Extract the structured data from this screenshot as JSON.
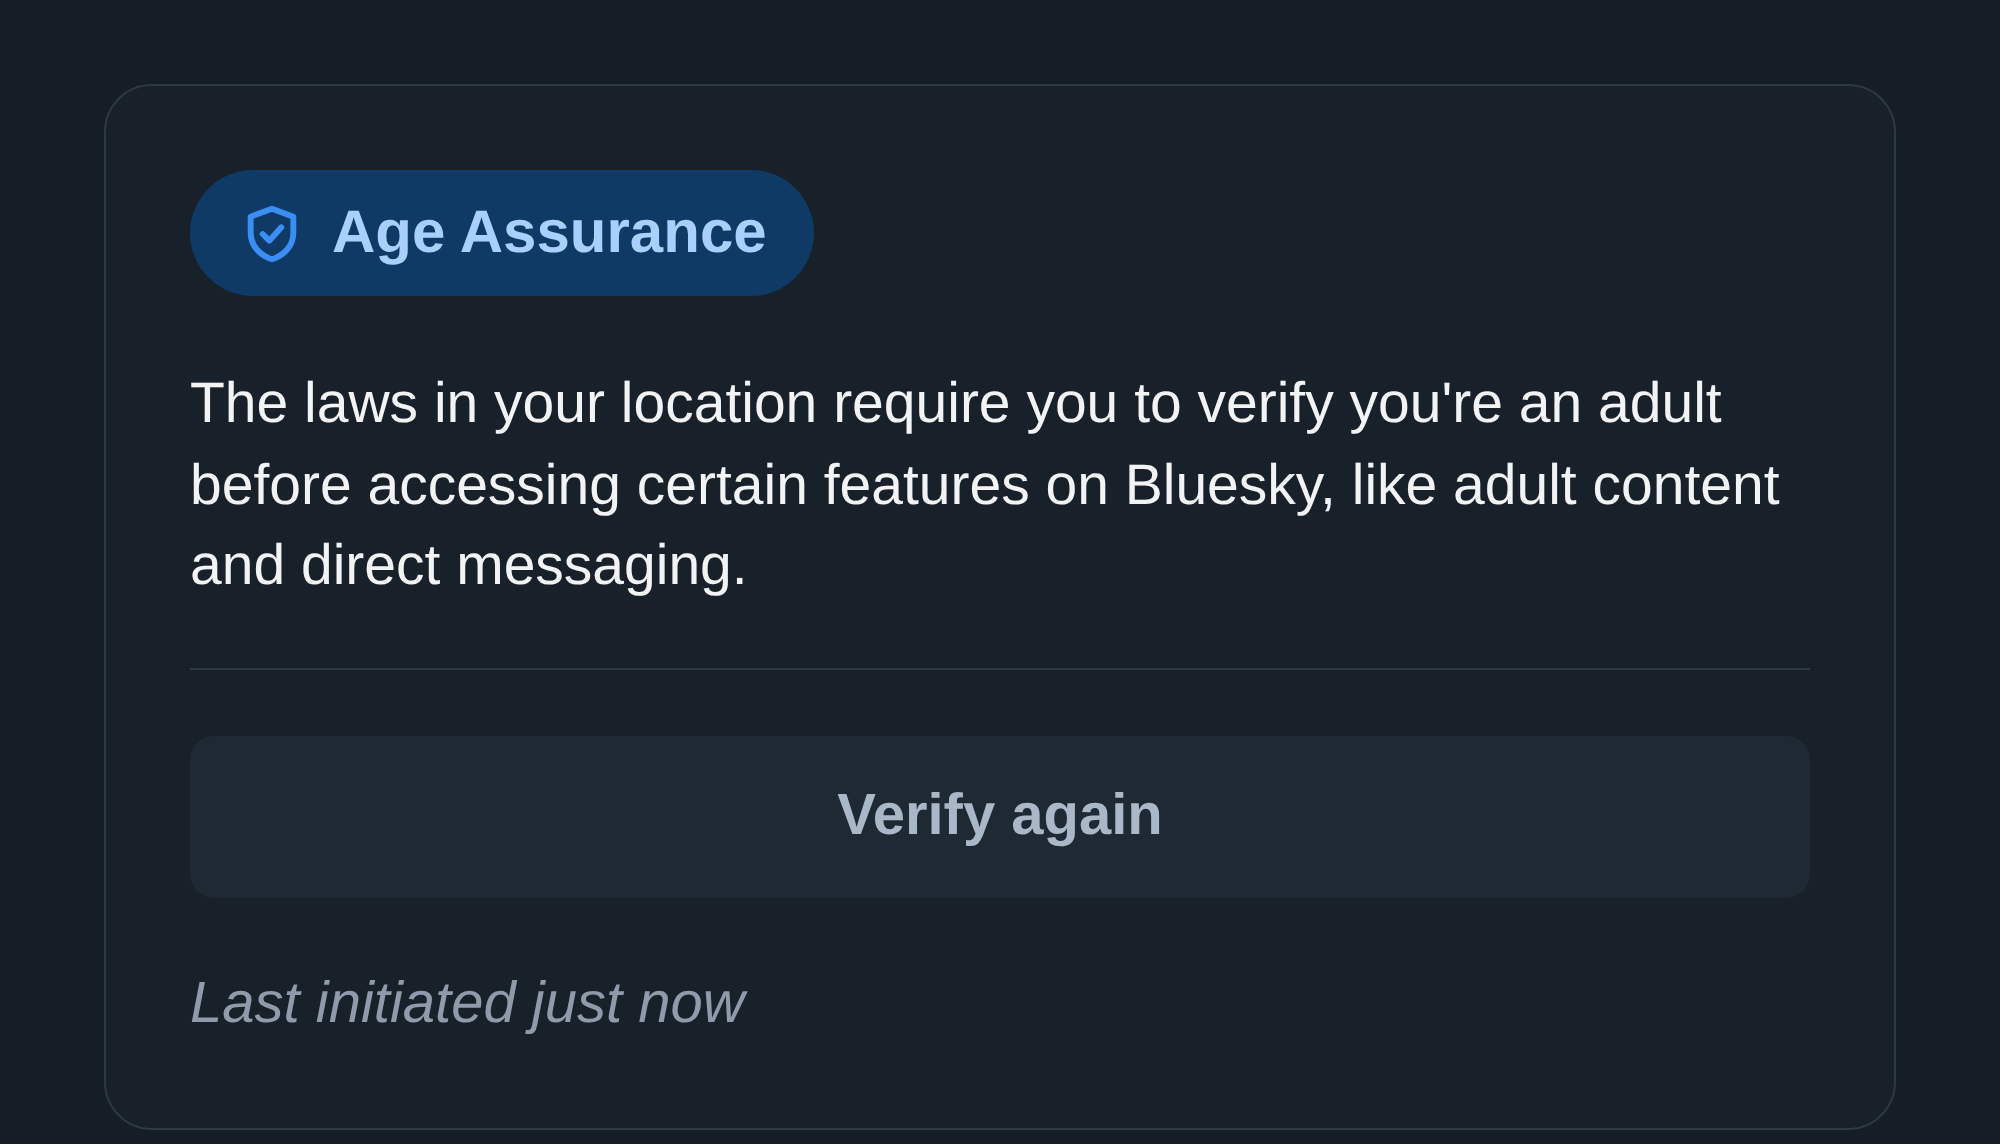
{
  "badge": {
    "label": "Age Assurance"
  },
  "description": "The laws in your location require you to verify you're an adult before accessing certain features on Bluesky, like adult content and direct messaging.",
  "button": {
    "label": "Verify again"
  },
  "status": "Last initiated just now"
}
